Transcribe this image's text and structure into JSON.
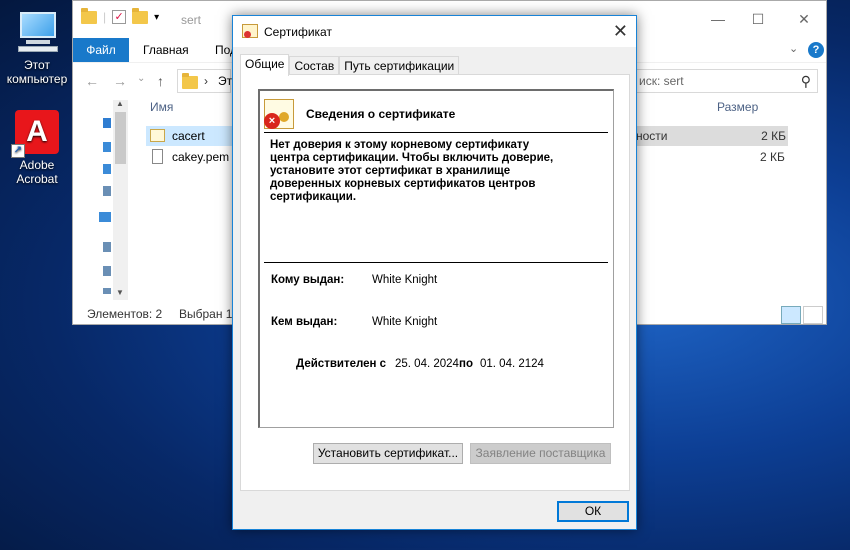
{
  "desktop": {
    "icons": [
      {
        "label_line1": "Этот",
        "label_line2": "компьютер"
      },
      {
        "label_line1": "Adobe",
        "label_line2": "Acrobat"
      }
    ]
  },
  "explorer": {
    "title": "sert",
    "ribbon": {
      "file": "Файл",
      "home": "Главная",
      "share": "Под"
    },
    "address": {
      "breadcrumb_prefix": "Это",
      "search_placeholder": "иск: sert"
    },
    "columns": {
      "name": "Имя",
      "size": "Размер",
      "type_fragment": "ности"
    },
    "files": [
      {
        "name": "cacert",
        "size": "2 КБ"
      },
      {
        "name": "cakey.pem",
        "size": "2 КБ"
      }
    ],
    "status": {
      "items": "Элементов: 2",
      "selected": "Выбран 1"
    }
  },
  "dialog": {
    "title": "Сертификат",
    "tabs": [
      "Общие",
      "Состав",
      "Путь сертификации"
    ],
    "info_heading": "Сведения о сертификате",
    "message_lines": [
      "Нет доверия к этому корневому сертификату",
      "центра сертификации. Чтобы включить  доверие,",
      "установите этот сертификат в хранилище",
      "доверенных корневых сертификатов центров",
      "сертификации."
    ],
    "issued_to_label": "Кому выдан:",
    "issued_to_value": "White Knight",
    "issued_by_label": "Кем выдан:",
    "issued_by_value": "White Knight",
    "valid_from_label": "Действителен с",
    "valid_from_value": "25. 04. 2024",
    "valid_to_label": "по",
    "valid_to_value": "01. 04. 2124",
    "install_button": "Установить сертификат...",
    "issuer_statement_button": "Заявление поставщика",
    "ok_button": "ОК"
  }
}
